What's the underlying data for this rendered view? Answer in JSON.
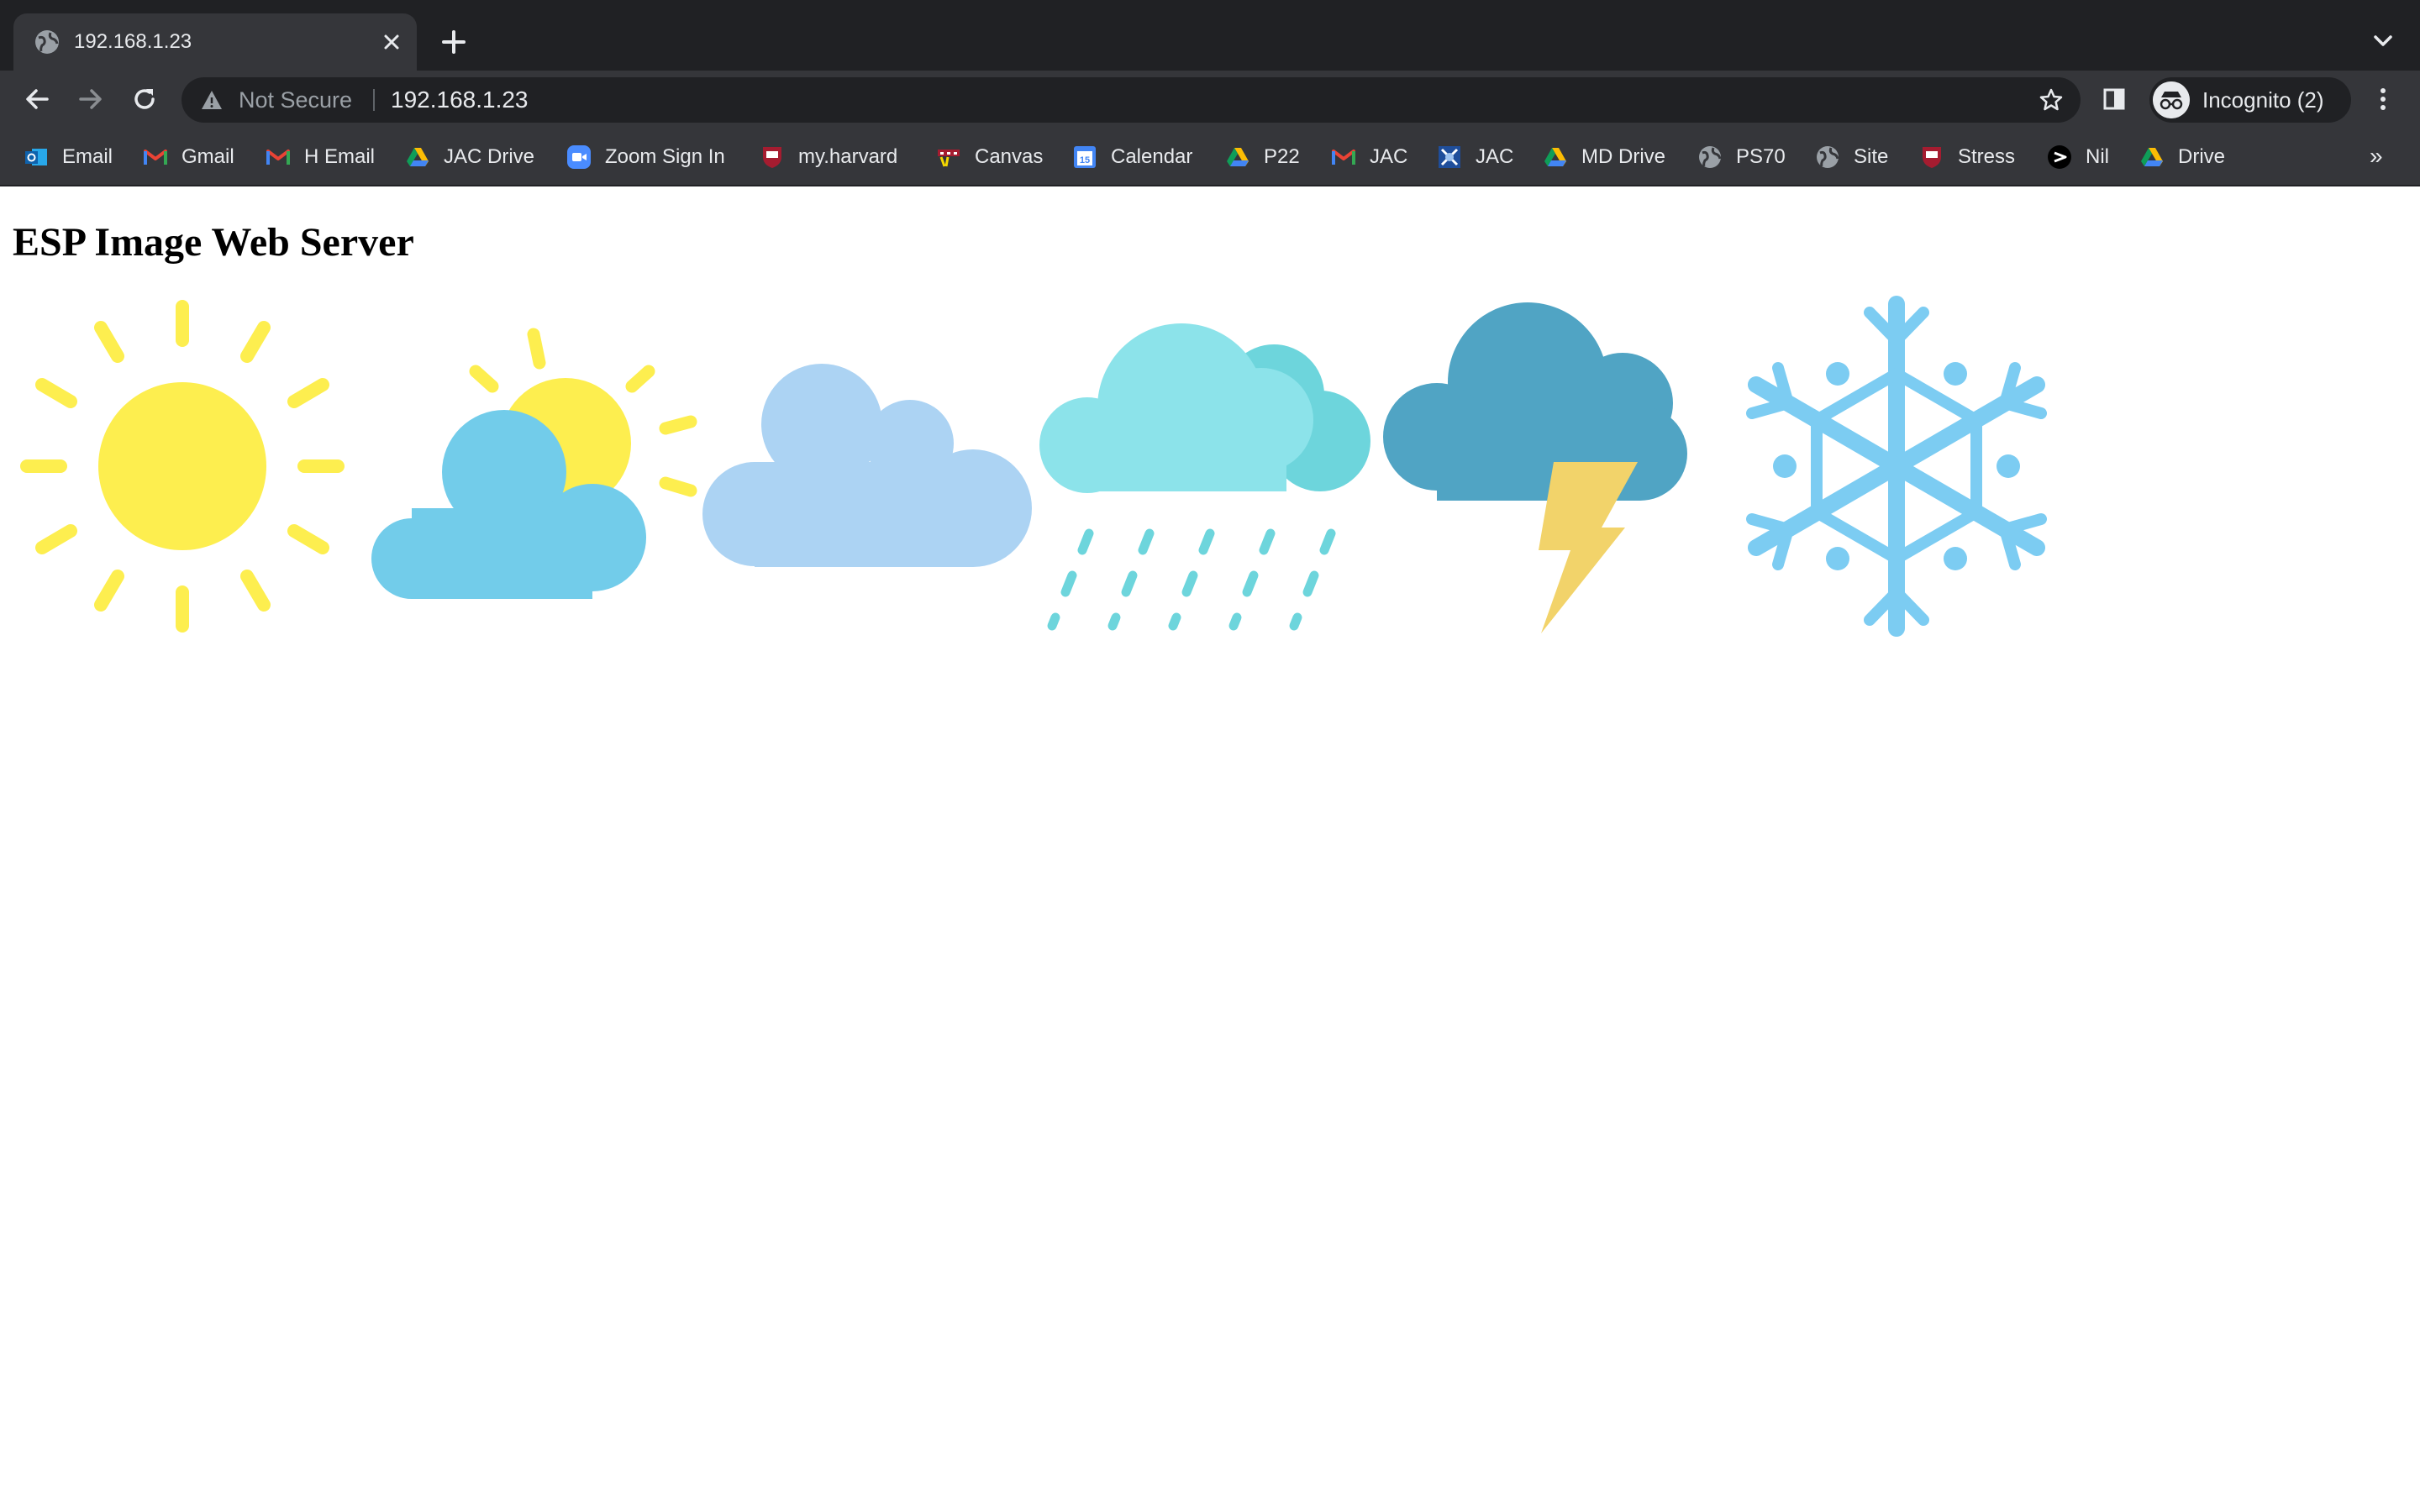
{
  "browser": {
    "tab": {
      "title": "192.168.1.23"
    },
    "omnibox": {
      "security_label": "Not Secure",
      "url": "192.168.1.23"
    },
    "profile": {
      "label": "Incognito (2)"
    },
    "bookmarks": [
      {
        "label": "Email",
        "icon": "outlook-icon"
      },
      {
        "label": "Gmail",
        "icon": "gmail-icon"
      },
      {
        "label": "H Email",
        "icon": "gmail-icon"
      },
      {
        "label": "JAC Drive",
        "icon": "google-drive-icon"
      },
      {
        "label": "Zoom Sign In",
        "icon": "zoom-icon"
      },
      {
        "label": "my.harvard",
        "icon": "harvard-shield-icon"
      },
      {
        "label": "Canvas",
        "icon": "canvas-icon"
      },
      {
        "label": "Calendar",
        "icon": "google-calendar-icon"
      },
      {
        "label": "P22",
        "icon": "google-drive-icon"
      },
      {
        "label": "JAC",
        "icon": "gmail-icon"
      },
      {
        "label": "JAC",
        "icon": "jac-icon"
      },
      {
        "label": "MD Drive",
        "icon": "google-drive-icon"
      },
      {
        "label": "PS70",
        "icon": "globe-icon"
      },
      {
        "label": "Site",
        "icon": "globe-icon"
      },
      {
        "label": "Stress",
        "icon": "harvard-shield-icon"
      },
      {
        "label": "Nil",
        "icon": "nil-icon"
      },
      {
        "label": "Drive",
        "icon": "google-drive-icon"
      }
    ],
    "bookmarks_overflow": "»"
  },
  "page": {
    "title": "ESP Image Web Server",
    "images": [
      "sun-icon",
      "partly-cloudy-icon",
      "cloud-icon",
      "rain-cloud-icon",
      "thunderstorm-icon",
      "snowflake-icon"
    ]
  },
  "colors": {
    "tabstrip": "#202124",
    "toolbar": "#35363a",
    "sun_yellow": "#fdee4f",
    "cloud_sky": "#72ccea",
    "cloud_pale": "#acd3f3",
    "rain_cloud": "#8ce3ea",
    "storm_cloud": "#50a4c4",
    "lightning": "#f2d36a",
    "snow": "#7cccf2"
  }
}
